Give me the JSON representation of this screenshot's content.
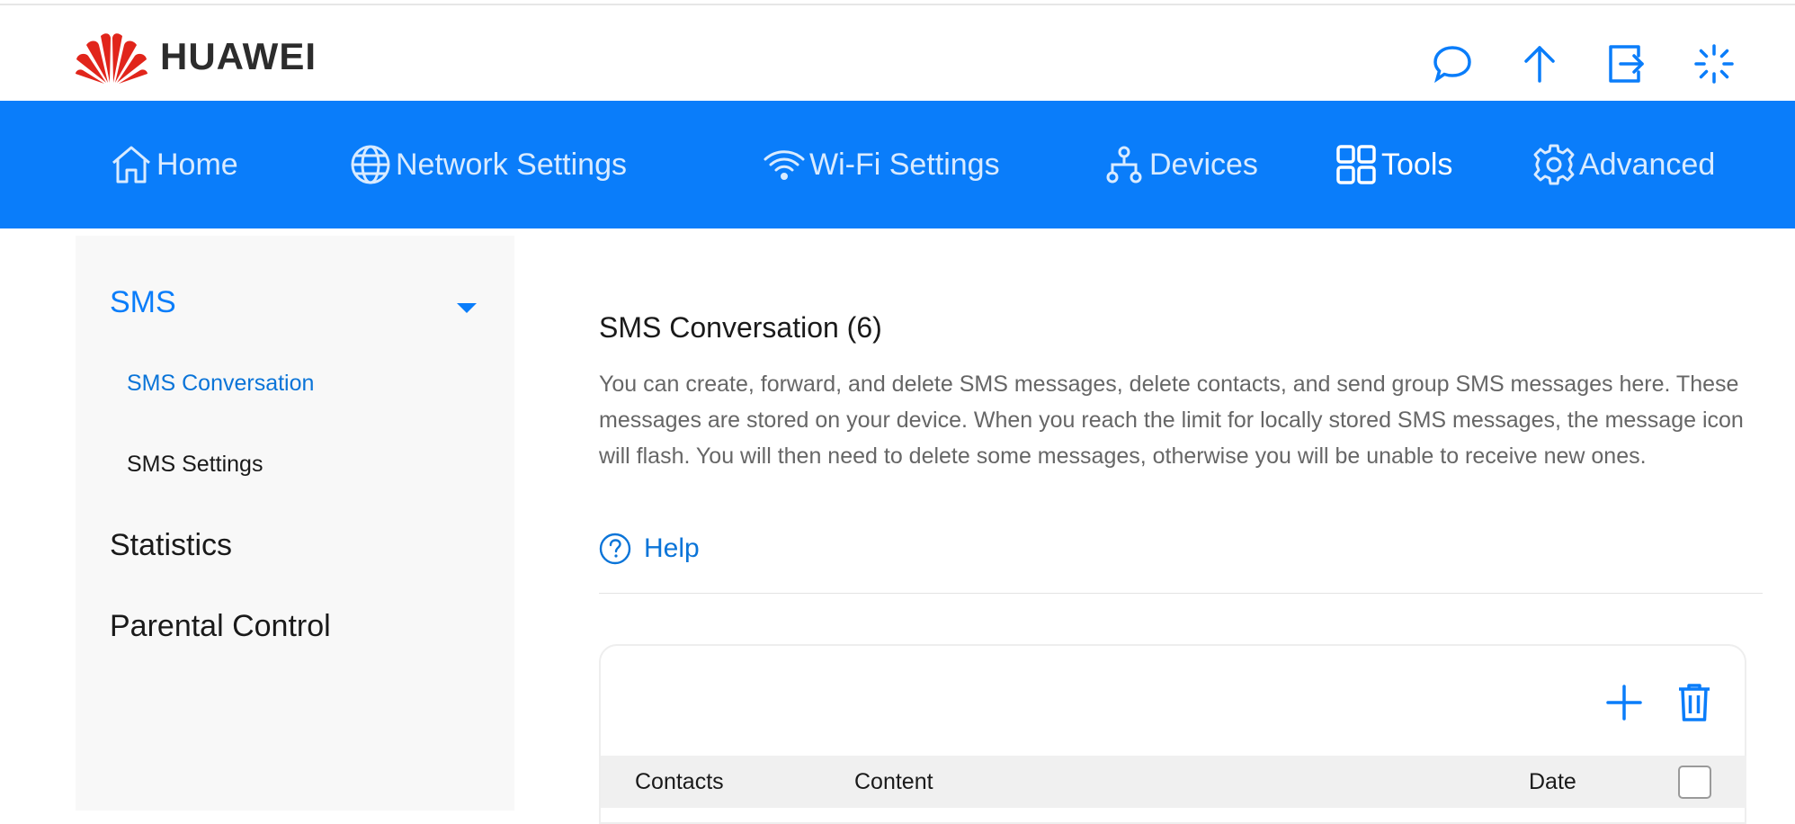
{
  "header": {
    "logo_text": "HUAWEI",
    "icons": [
      "message-icon",
      "upload-icon",
      "logout-icon",
      "loading-icon"
    ]
  },
  "nav": {
    "items": [
      {
        "label": "Home",
        "icon": "home-icon"
      },
      {
        "label": "Network Settings",
        "icon": "globe-icon"
      },
      {
        "label": "Wi-Fi Settings",
        "icon": "wifi-icon"
      },
      {
        "label": "Devices",
        "icon": "devices-icon"
      },
      {
        "label": "Tools",
        "icon": "tools-icon",
        "active": true
      },
      {
        "label": "Advanced",
        "icon": "gear-icon"
      }
    ]
  },
  "sidebar": {
    "groups": [
      {
        "label": "SMS",
        "expanded": true,
        "items": [
          {
            "label": "SMS Conversation",
            "active": true
          },
          {
            "label": "SMS Settings"
          }
        ]
      },
      {
        "label": "Statistics"
      },
      {
        "label": "Parental Control"
      }
    ]
  },
  "main": {
    "title": "SMS Conversation (6)",
    "description": "You can create, forward, and delete SMS messages, delete contacts, and send group SMS messages here. These messages are stored on your device. When you reach the limit for locally stored SMS messages, the message icon will flash. You will then need to delete some messages, otherwise you will be unable to receive new ones.",
    "help_label": "Help",
    "table": {
      "columns": [
        "Contacts",
        "Content",
        "Date"
      ],
      "select_all_checked": false
    }
  },
  "colors": {
    "brand_blue": "#0a7dfa",
    "link_blue": "#0a74d8",
    "logo_red": "#e1251b"
  }
}
